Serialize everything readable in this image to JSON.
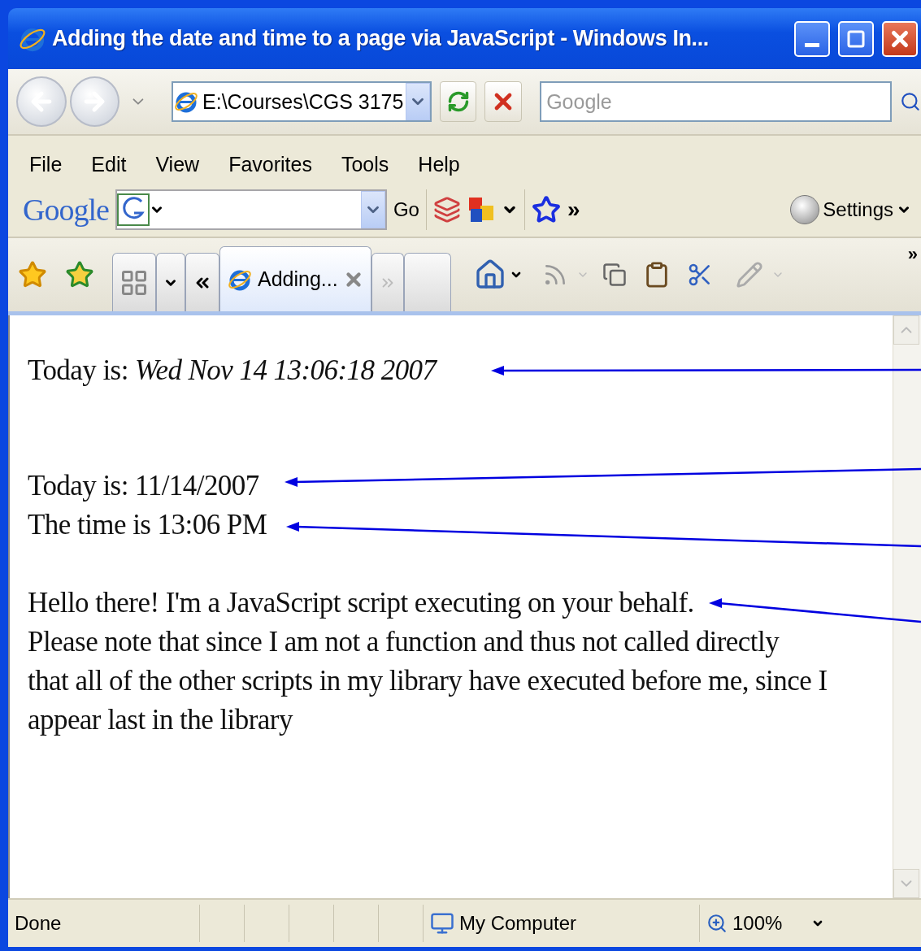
{
  "window": {
    "title": "Adding the date and time to a page via JavaScript - Windows In..."
  },
  "address_bar": {
    "value": "E:\\Courses\\CGS 3175"
  },
  "search": {
    "placeholder": "Google"
  },
  "menu": [
    "File",
    "Edit",
    "View",
    "Favorites",
    "Tools",
    "Help"
  ],
  "google_toolbar": {
    "logo": "Google",
    "go": "Go",
    "more": "»",
    "settings": "Settings"
  },
  "tabs": [
    {
      "label": "Adding...",
      "selected": true
    }
  ],
  "command_bar": {
    "more": "»"
  },
  "content": [
    {
      "lines": [
        "Today is: *Wed Nov 14 13:06:18 2007*"
      ]
    },
    {
      "lines": [
        "Today is: 11/14/2007",
        "The time is 13:06 PM"
      ]
    },
    {
      "lines": [
        "Hello there! I'm a JavaScript script executing on your behalf.",
        "Please note that since I am not a function and thus not called directly",
        "that all of the other scripts in my library have executed before me, since I",
        "appear last in the library"
      ]
    }
  ],
  "status_bar": {
    "status": "Done",
    "zone": "My Computer",
    "zoom": "100%"
  }
}
